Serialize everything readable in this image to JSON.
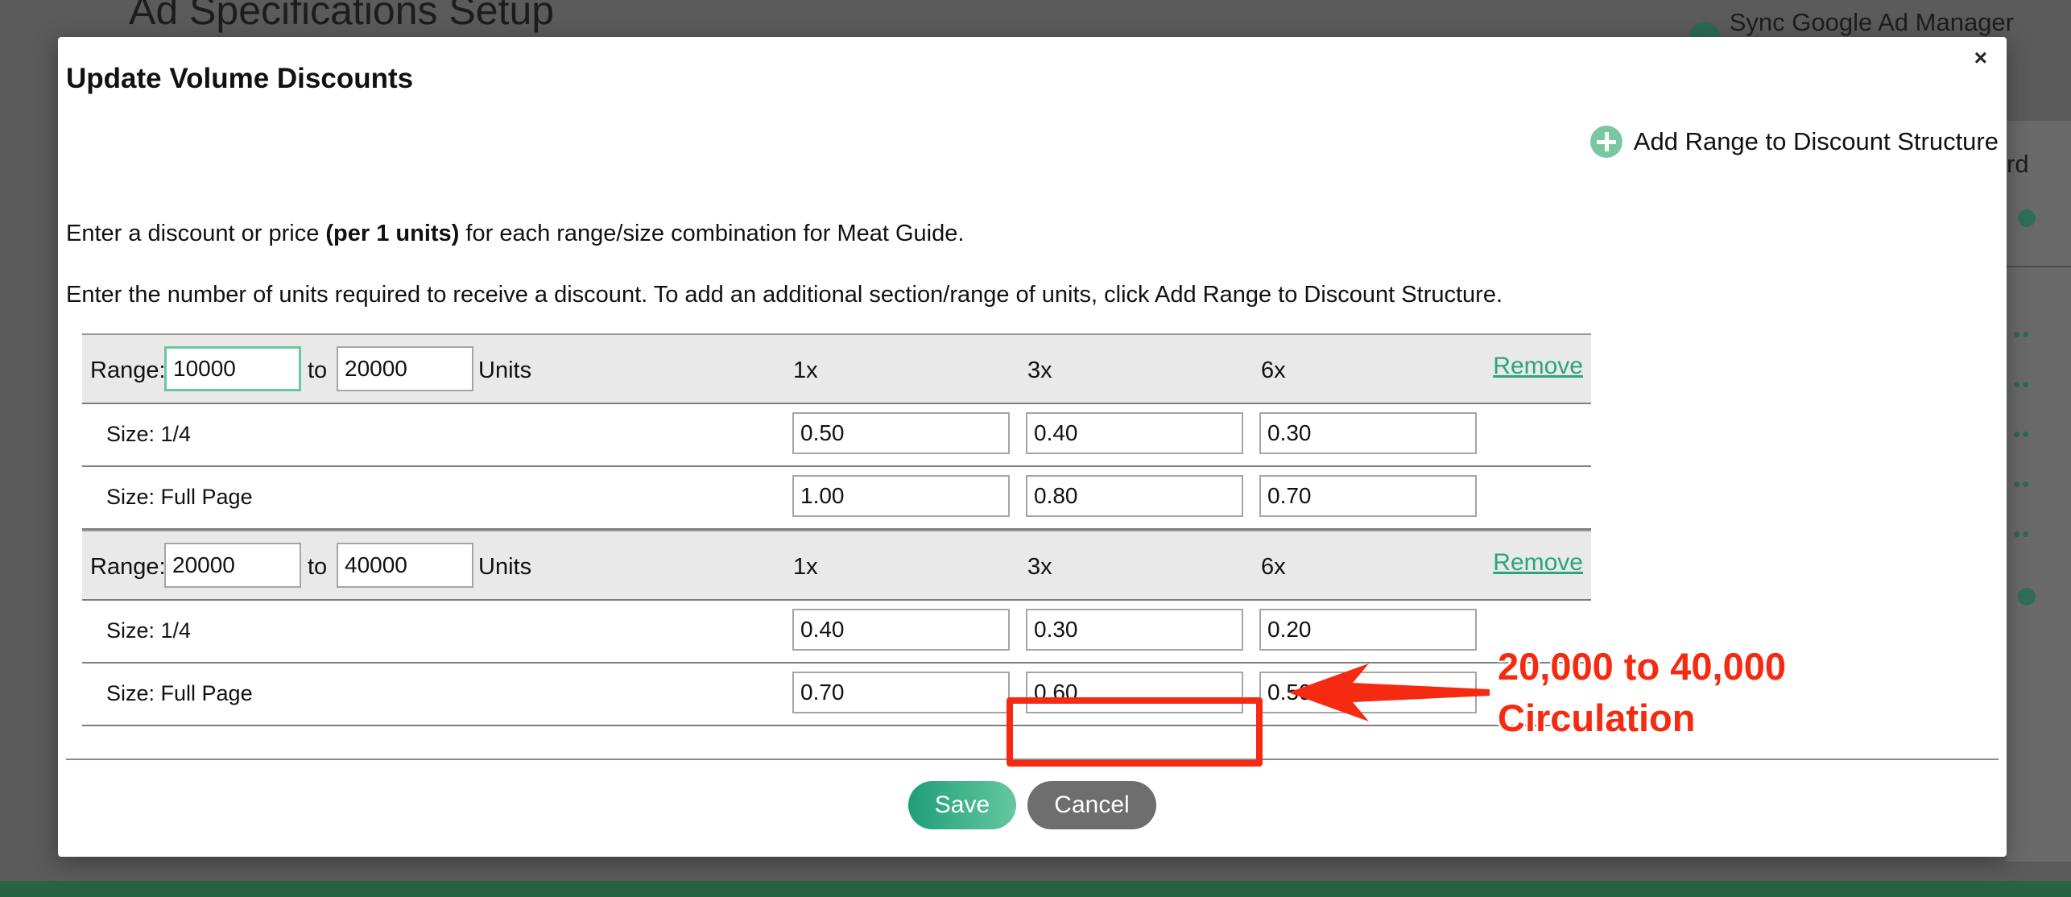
{
  "background": {
    "title": "Ad Specifications Setup",
    "sync_label": "Sync Google Ad Manager Data",
    "side_fragment": "rd"
  },
  "modal": {
    "title": "Update Volume Discounts",
    "close_symbol": "×",
    "add_range_label": "Add Range to Discount Structure",
    "intro_prefix": "Enter a discount or price ",
    "intro_bold": "(per 1 units)",
    "intro_suffix": " for each range/size combination for Meat Guide.",
    "intro_line2": "Enter the number of units required to receive a discount. To add an additional section/range of units, click Add Range to Discount Structure.",
    "range_label": "Range:",
    "to_label": "to",
    "units_label": "Units",
    "remove_label": "Remove",
    "columns": [
      "1x",
      "3x",
      "6x"
    ],
    "ranges": [
      {
        "from": "10000",
        "to": "20000",
        "sizes": [
          {
            "label": "Size: 1/4",
            "values": [
              "0.50",
              "0.40",
              "0.30"
            ]
          },
          {
            "label": "Size: Full Page",
            "values": [
              "1.00",
              "0.80",
              "0.70"
            ]
          }
        ]
      },
      {
        "from": "20000",
        "to": "40000",
        "sizes": [
          {
            "label": "Size: 1/4",
            "values": [
              "0.40",
              "0.30",
              "0.20"
            ]
          },
          {
            "label": "Size: Full Page",
            "values": [
              "0.70",
              "0.60",
              "0.50"
            ]
          }
        ]
      }
    ],
    "save_label": "Save",
    "cancel_label": "Cancel"
  },
  "annotation": {
    "line1": "20,000 to 40,000",
    "line2": "Circulation",
    "color": "#f52a10"
  },
  "colors": {
    "accent": "#2aa57c",
    "overlay": "#5b5b5b"
  }
}
